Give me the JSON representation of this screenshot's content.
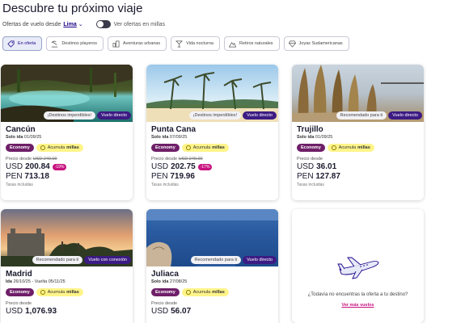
{
  "page": {
    "title": "Descubre tu próximo viaje",
    "origin_label": "Ofertas de vuelo desde",
    "origin_city": "Lima",
    "miles_toggle_label": "Ver ofertas en millas"
  },
  "filters": [
    {
      "label": "En oferta",
      "icon": "tag-icon",
      "active": true
    },
    {
      "label": "Destinos playeros",
      "icon": "beach-icon",
      "active": false
    },
    {
      "label": "Aventuras urbanas",
      "icon": "city-icon",
      "active": false
    },
    {
      "label": "Vida nocturna",
      "icon": "cocktail-icon",
      "active": false
    },
    {
      "label": "Retiros naturales",
      "icon": "mountain-icon",
      "active": false
    },
    {
      "label": "Joyas Sudamericanas",
      "icon": "gem-icon",
      "active": false
    }
  ],
  "common": {
    "economy": "Economy",
    "accumulate": "Acumula",
    "miles": "millas",
    "price_from": "Precio desde",
    "usd": "USD",
    "pen": "PEN",
    "taxes": "Tasas incluidas"
  },
  "cards": [
    {
      "destination": "Cancún",
      "trip_type": "Solo ida",
      "dates": "01/09/25",
      "badges": [
        "¡Destinos imperdibles!",
        "Vuelo directo"
      ],
      "usd_old": "USD 249.00",
      "usd_price": "200.84",
      "discount": "-19%",
      "pen_price": "713.18",
      "show_taxes": true
    },
    {
      "destination": "Punta Cana",
      "trip_type": "Solo ida",
      "dates": "07/09/25",
      "badges": [
        "¡Destinos imperdibles!",
        "Vuelo directo"
      ],
      "usd_old": "USD 249.00",
      "usd_price": "202.75",
      "discount": "-17%",
      "pen_price": "719.96",
      "show_taxes": true
    },
    {
      "destination": "Trujillo",
      "trip_type": "Solo ida",
      "dates": "01/09/25",
      "badges": [
        "Recomendado para ti",
        "Vuelo directo"
      ],
      "usd_old": "",
      "usd_price": "36.01",
      "discount": "",
      "pen_price": "127.87",
      "show_taxes": true
    },
    {
      "destination": "Madrid",
      "trip_type": "Ida",
      "dates": "26/10/25 - Vuelta 05/11/25",
      "badges": [
        "Recomendado para ti",
        "Vuelo con conexión"
      ],
      "usd_old": "",
      "usd_price": "1,076.93",
      "discount": "",
      "pen_price": "",
      "show_taxes": false
    },
    {
      "destination": "Juliaca",
      "trip_type": "Solo ida",
      "dates": "27/08/25",
      "badges": [
        "Recomendado para ti",
        "Vuelo directo"
      ],
      "usd_old": "",
      "usd_price": "56.07",
      "discount": "",
      "pen_price": "",
      "show_taxes": false
    }
  ],
  "promo": {
    "question": "¿Todavía no encuentras la oferta a tu destino?",
    "link": "Ver más vuelos"
  },
  "colors": {
    "brand": "#1b0088",
    "badge_dark": "#3c1b83",
    "economy": "#6e1f68",
    "miles": "#fff48a",
    "discount": "#c8137f"
  }
}
